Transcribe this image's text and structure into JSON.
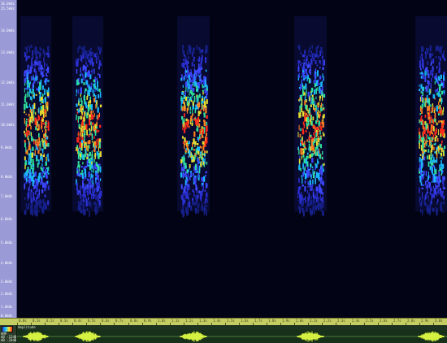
{
  "spectrogram": {
    "freq_labels": [
      "16.0kHz",
      "15.5kHz",
      "14.0kHz",
      "13.0kHz",
      "12.0kHz",
      "11.0kHz",
      "10.0kHz",
      "9.0kHz",
      "8.0kHz",
      "7.0kHz",
      "6.0kHz",
      "5.0kHz",
      "4.0kHz",
      "3.0kHz",
      "2.0kHz",
      "1.0kHz",
      "0.0kHz"
    ],
    "colors": {
      "background": "#020415",
      "axis_panel": "#9a9bd6",
      "ruler": "#c4cc62",
      "wave_bg": "#173019",
      "wave_fg": "#d4f040"
    }
  },
  "ruler": {
    "labels": [
      "0.0s",
      "0.1s",
      "0.2s",
      "0.3s",
      "0.4s",
      "0.5s",
      "0.6s",
      "0.7s",
      "0.8s",
      "0.9s",
      "1.0s",
      "1.1s",
      "1.2s",
      "1.3s",
      "1.4s",
      "1.5s",
      "1.6s",
      "1.7s",
      "1.8s",
      "1.9s",
      "2.0s",
      "2.1s",
      "2.2s",
      "2.3s",
      "2.4s",
      "2.5s",
      "2.6s",
      "2.7s",
      "2.8s",
      "2.9s",
      "3.0s"
    ]
  },
  "waveform": {
    "title": "Amplitude",
    "side_labels": [
      "AMP",
      "dB -12dB",
      "dB -24dB"
    ]
  }
}
